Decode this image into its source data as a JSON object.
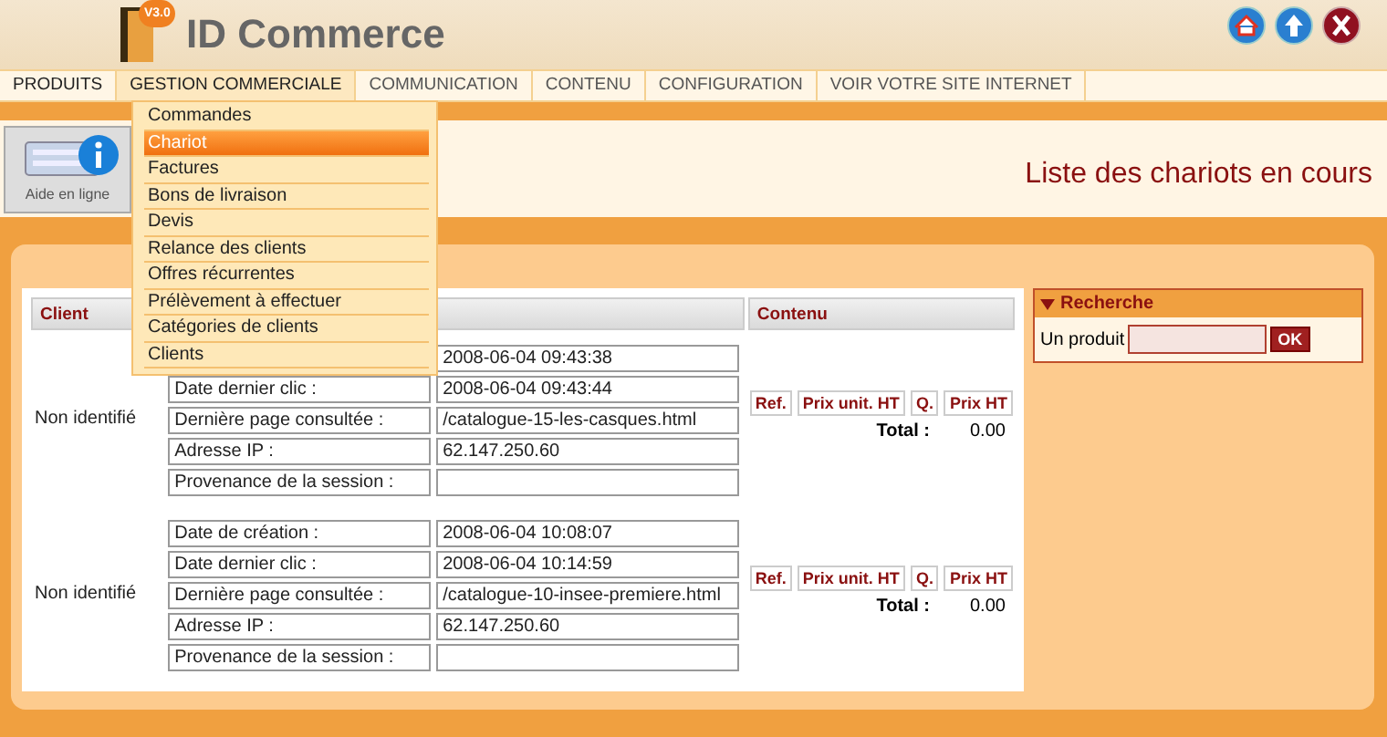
{
  "app": {
    "name": "ID Commerce",
    "version": "V3.0"
  },
  "nav": [
    {
      "label": "PRODUITS",
      "selected": false
    },
    {
      "label": "GESTION COMMERCIALE",
      "selected": true
    },
    {
      "label": "COMMUNICATION",
      "selected": false
    },
    {
      "label": "CONTENU",
      "selected": false
    },
    {
      "label": "CONFIGURATION",
      "selected": false
    },
    {
      "label": "VOIR VOTRE SITE INTERNET",
      "selected": false
    }
  ],
  "menu": [
    {
      "label": "Commandes",
      "selected": false
    },
    {
      "label": "Chariot",
      "selected": true
    },
    {
      "label": "Factures",
      "selected": false
    },
    {
      "label": "Bons de livraison",
      "selected": false
    },
    {
      "label": "Devis",
      "selected": false
    },
    {
      "label": "Relance des clients",
      "selected": false
    },
    {
      "label": "Offres récurrentes",
      "selected": false
    },
    {
      "label": "Prélèvement à effectuer",
      "selected": false
    },
    {
      "label": "Catégories de clients",
      "selected": false
    },
    {
      "label": "Clients",
      "selected": false
    }
  ],
  "help_button": "Aide en ligne",
  "page_title": "Liste des chariots en cours",
  "table": {
    "columns": [
      "Client",
      "Contenu"
    ],
    "rows": [
      {
        "client": "Non identifié",
        "fields": [
          {
            "value": "2008-06-04 09:43:38"
          },
          {
            "label": "Date dernier clic :",
            "value": "2008-06-04 09:43:44"
          },
          {
            "label": "Dernière page consultée :",
            "value": "/catalogue-15-les-casques.html"
          },
          {
            "label": "Adresse IP :",
            "value": "62.147.250.60"
          },
          {
            "label": "Provenance de la session :"
          }
        ],
        "content_headers": [
          "Ref.",
          "Prix unit. HT",
          "Q.",
          "Prix HT"
        ],
        "total_label": "Total :",
        "total": "0.00"
      },
      {
        "client": "Non identifié",
        "fields": [
          {
            "label": "Date de création :",
            "value": "2008-06-04 10:08:07"
          },
          {
            "label": "Date dernier clic :",
            "value": "2008-06-04 10:14:59"
          },
          {
            "label": "Dernière page consultée :",
            "value": "/catalogue-10-insee-premiere.html"
          },
          {
            "label": "Adresse IP :",
            "value": "62.147.250.60"
          },
          {
            "label": "Provenance de la session :"
          }
        ],
        "content_headers": [
          "Ref.",
          "Prix unit. HT",
          "Q.",
          "Prix HT"
        ],
        "total_label": "Total :",
        "total": "0.00"
      }
    ]
  },
  "search": {
    "title": "Recherche",
    "label": "Un produit",
    "button": "OK"
  }
}
